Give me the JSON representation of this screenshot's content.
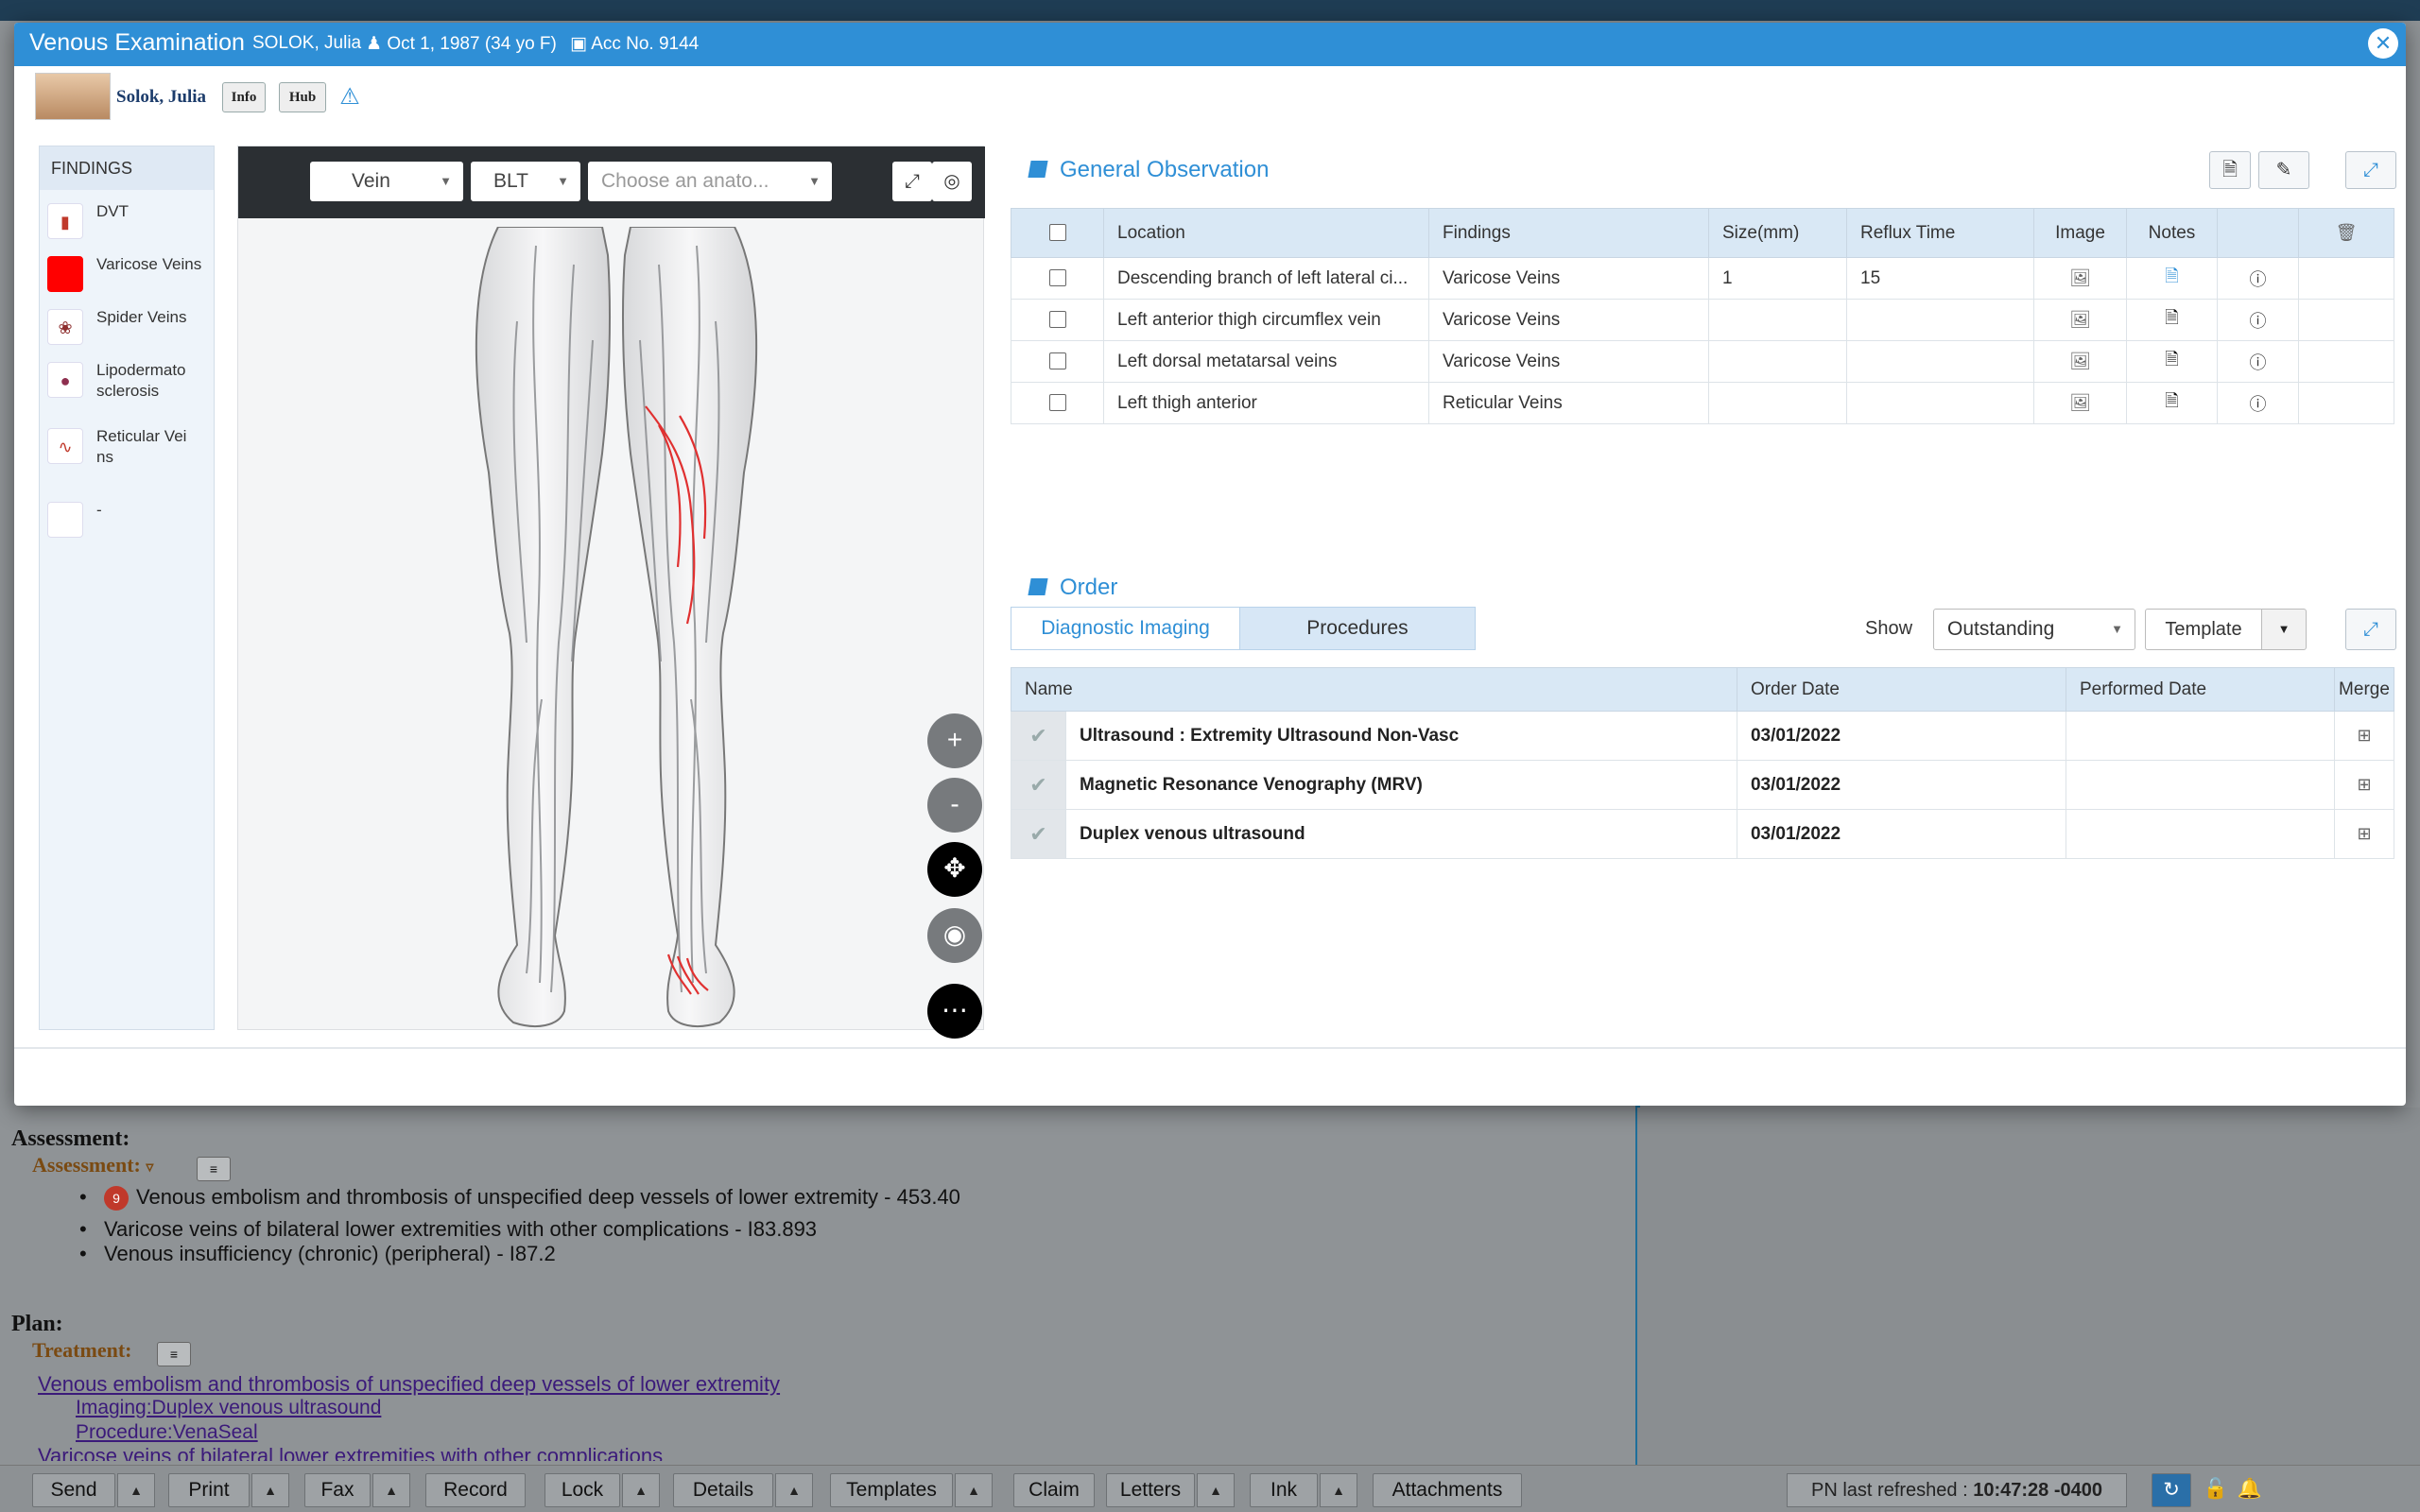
{
  "modal": {
    "title": "Venous Examination",
    "patient_header": "SOLOK, Julia",
    "dob": "Oct 1, 1987 (34 yo F)",
    "acc": "Acc No. 9144"
  },
  "patient": {
    "name": "Solok, Julia",
    "info_label": "Info",
    "hub_label": "Hub"
  },
  "findings": {
    "title": "FINDINGS",
    "items": [
      {
        "label": "DVT",
        "color": "#c0392b"
      },
      {
        "label": "Varicose Veins",
        "color": "#ff0000"
      },
      {
        "label": "Spider Veins",
        "color": "#8e2f2f"
      },
      {
        "label": "Lipodermato sclerosis",
        "color": "#8e2f4f"
      },
      {
        "label": "Reticular Vei ns",
        "color": "#c0392b"
      },
      {
        "label": "-",
        "color": "#ffffff"
      }
    ]
  },
  "viewer": {
    "vessel": "Vein",
    "side": "BLT",
    "anatomy_placeholder": "Choose an anato...",
    "zoom_in": "+",
    "zoom_out": "-"
  },
  "general_observation": {
    "title": "General Observation",
    "columns": [
      "Location",
      "Findings",
      "Size(mm)",
      "Reflux Time",
      "Image",
      "Notes"
    ],
    "rows": [
      {
        "location": "Descending branch of left lateral ci...",
        "finding": "Varicose Veins",
        "size": "1",
        "reflux": "15"
      },
      {
        "location": "Left anterior thigh circumflex vein",
        "finding": "Varicose Veins",
        "size": "",
        "reflux": ""
      },
      {
        "location": "Left dorsal metatarsal veins",
        "finding": "Varicose Veins",
        "size": "",
        "reflux": ""
      },
      {
        "location": "Left thigh anterior",
        "finding": "Reticular Veins",
        "size": "",
        "reflux": ""
      }
    ]
  },
  "order": {
    "title": "Order",
    "tabs": [
      "Diagnostic Imaging",
      "Procedures"
    ],
    "show_label": "Show",
    "show_value": "Outstanding",
    "template_label": "Template",
    "columns": [
      "Name",
      "Order Date",
      "Performed Date",
      "Merge"
    ],
    "rows": [
      {
        "name": "Ultrasound : Extremity Ultrasound Non-Vasc",
        "order_date": "03/01/2022",
        "performed_date": ""
      },
      {
        "name": "Magnetic Resonance Venography (MRV)",
        "order_date": "03/01/2022",
        "performed_date": ""
      },
      {
        "name": "Duplex venous ultrasound",
        "order_date": "03/01/2022",
        "performed_date": ""
      }
    ]
  },
  "background_doc": {
    "assessment_heading": "Assessment:",
    "assessment_sub": "Assessment:",
    "assessment_items": [
      "Venous embolism and thrombosis of unspecified deep vessels of lower extremity - 453.40",
      "Varicose veins of bilateral lower extremities with other complications - I83.893",
      "Venous insufficiency (chronic) (peripheral) - I87.2"
    ],
    "first_item_badge": "9",
    "plan_heading": "Plan:",
    "treatment_sub": "Treatment:",
    "plan_link": "Venous embolism and thrombosis of unspecified deep vessels of lower extremity",
    "plan_imaging": "Imaging:Duplex venous ultrasound",
    "plan_procedure": "Procedure:VenaSeal",
    "plan_cut": "Varicose veins of bilateral lower extremities with other complications"
  },
  "bottom_bar": {
    "send": "Send",
    "print": "Print",
    "fax": "Fax",
    "record": "Record",
    "lock": "Lock",
    "details": "Details",
    "templates": "Templates",
    "claim": "Claim",
    "letters": "Letters",
    "ink": "Ink",
    "attachments": "Attachments",
    "pn_label": "PN last refreshed :",
    "pn_time": "10:47:28 -0400"
  }
}
